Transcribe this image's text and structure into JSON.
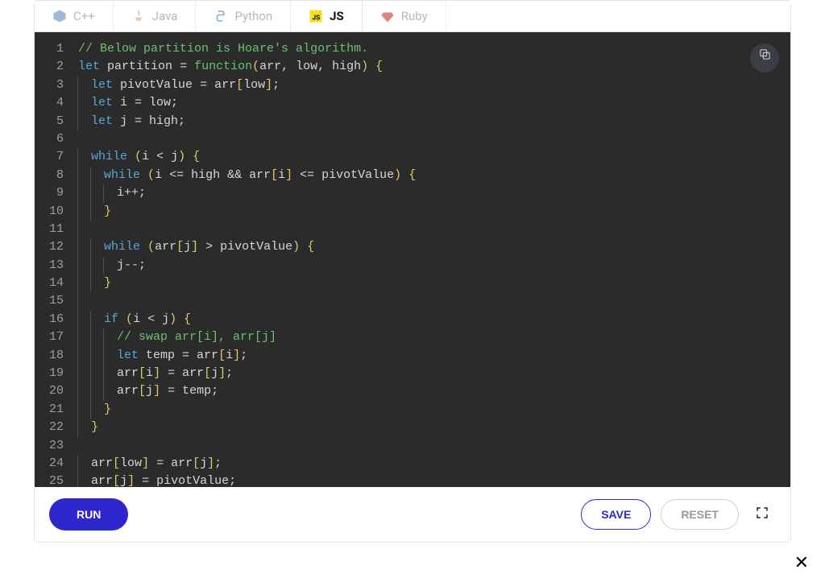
{
  "tabs": [
    {
      "label": "C++",
      "active": false
    },
    {
      "label": "Java",
      "active": false
    },
    {
      "label": "Python",
      "active": false
    },
    {
      "label": "JS",
      "active": true
    },
    {
      "label": "Ruby",
      "active": false
    }
  ],
  "buttons": {
    "run": "RUN",
    "save": "SAVE",
    "reset": "RESET"
  },
  "code_lines": [
    {
      "n": 1,
      "indent": 0,
      "tokens": [
        {
          "c": "comment",
          "t": "// Below partition is Hoare's algorithm."
        }
      ]
    },
    {
      "n": 2,
      "indent": 0,
      "tokens": [
        {
          "c": "keyword",
          "t": "let"
        },
        {
          "c": "op",
          "t": " "
        },
        {
          "c": "ident",
          "t": "partition"
        },
        {
          "c": "op",
          "t": " = "
        },
        {
          "c": "func",
          "t": "function"
        },
        {
          "c": "paren",
          "t": "("
        },
        {
          "c": "ident",
          "t": "arr, low, high"
        },
        {
          "c": "paren",
          "t": ")"
        },
        {
          "c": "op",
          "t": " "
        },
        {
          "c": "brace",
          "t": "{"
        }
      ]
    },
    {
      "n": 3,
      "indent": 1,
      "tokens": [
        {
          "c": "keyword",
          "t": "let"
        },
        {
          "c": "op",
          "t": " "
        },
        {
          "c": "ident",
          "t": "pivotValue = arr"
        },
        {
          "c": "bracket",
          "t": "["
        },
        {
          "c": "ident",
          "t": "low"
        },
        {
          "c": "bracket",
          "t": "]"
        },
        {
          "c": "op",
          "t": ";"
        }
      ]
    },
    {
      "n": 4,
      "indent": 1,
      "tokens": [
        {
          "c": "keyword",
          "t": "let"
        },
        {
          "c": "op",
          "t": " "
        },
        {
          "c": "ident",
          "t": "i = low;"
        }
      ]
    },
    {
      "n": 5,
      "indent": 1,
      "tokens": [
        {
          "c": "keyword",
          "t": "let"
        },
        {
          "c": "op",
          "t": " "
        },
        {
          "c": "ident",
          "t": "j = high;"
        }
      ]
    },
    {
      "n": 6,
      "indent": 1,
      "tokens": []
    },
    {
      "n": 7,
      "indent": 1,
      "tokens": [
        {
          "c": "keyword",
          "t": "while"
        },
        {
          "c": "op",
          "t": " "
        },
        {
          "c": "paren",
          "t": "("
        },
        {
          "c": "ident",
          "t": "i < j"
        },
        {
          "c": "paren",
          "t": ")"
        },
        {
          "c": "op",
          "t": " "
        },
        {
          "c": "brace",
          "t": "{"
        }
      ]
    },
    {
      "n": 8,
      "indent": 2,
      "tokens": [
        {
          "c": "keyword",
          "t": "while"
        },
        {
          "c": "op",
          "t": " "
        },
        {
          "c": "paren",
          "t": "("
        },
        {
          "c": "ident",
          "t": "i <= high && arr"
        },
        {
          "c": "bracket",
          "t": "["
        },
        {
          "c": "ident",
          "t": "i"
        },
        {
          "c": "bracket",
          "t": "]"
        },
        {
          "c": "ident",
          "t": " <= pivotValue"
        },
        {
          "c": "paren",
          "t": ")"
        },
        {
          "c": "op",
          "t": " "
        },
        {
          "c": "brace",
          "t": "{"
        }
      ]
    },
    {
      "n": 9,
      "indent": 3,
      "tokens": [
        {
          "c": "ident",
          "t": "i++;"
        }
      ]
    },
    {
      "n": 10,
      "indent": 2,
      "tokens": [
        {
          "c": "brace",
          "t": "}"
        }
      ]
    },
    {
      "n": 11,
      "indent": 2,
      "tokens": []
    },
    {
      "n": 12,
      "indent": 2,
      "tokens": [
        {
          "c": "keyword",
          "t": "while"
        },
        {
          "c": "op",
          "t": " "
        },
        {
          "c": "paren",
          "t": "("
        },
        {
          "c": "ident",
          "t": "arr"
        },
        {
          "c": "bracket",
          "t": "["
        },
        {
          "c": "ident",
          "t": "j"
        },
        {
          "c": "bracket",
          "t": "]"
        },
        {
          "c": "ident",
          "t": " > pivotValue"
        },
        {
          "c": "paren",
          "t": ")"
        },
        {
          "c": "op",
          "t": " "
        },
        {
          "c": "brace",
          "t": "{"
        }
      ]
    },
    {
      "n": 13,
      "indent": 3,
      "tokens": [
        {
          "c": "ident",
          "t": "j--;"
        }
      ]
    },
    {
      "n": 14,
      "indent": 2,
      "tokens": [
        {
          "c": "brace",
          "t": "}"
        }
      ]
    },
    {
      "n": 15,
      "indent": 2,
      "tokens": []
    },
    {
      "n": 16,
      "indent": 2,
      "tokens": [
        {
          "c": "keyword",
          "t": "if"
        },
        {
          "c": "op",
          "t": " "
        },
        {
          "c": "paren",
          "t": "("
        },
        {
          "c": "ident",
          "t": "i < j"
        },
        {
          "c": "paren",
          "t": ")"
        },
        {
          "c": "op",
          "t": " "
        },
        {
          "c": "brace",
          "t": "{"
        }
      ]
    },
    {
      "n": 17,
      "indent": 3,
      "tokens": [
        {
          "c": "comment",
          "t": "// swap arr[i], arr[j]"
        }
      ]
    },
    {
      "n": 18,
      "indent": 3,
      "tokens": [
        {
          "c": "keyword",
          "t": "let"
        },
        {
          "c": "op",
          "t": " "
        },
        {
          "c": "ident",
          "t": "temp = arr"
        },
        {
          "c": "bracket",
          "t": "["
        },
        {
          "c": "ident",
          "t": "i"
        },
        {
          "c": "bracket",
          "t": "]"
        },
        {
          "c": "op",
          "t": ";"
        }
      ]
    },
    {
      "n": 19,
      "indent": 3,
      "tokens": [
        {
          "c": "ident",
          "t": "arr"
        },
        {
          "c": "bracket",
          "t": "["
        },
        {
          "c": "ident",
          "t": "i"
        },
        {
          "c": "bracket",
          "t": "]"
        },
        {
          "c": "ident",
          "t": " = arr"
        },
        {
          "c": "bracket",
          "t": "["
        },
        {
          "c": "ident",
          "t": "j"
        },
        {
          "c": "bracket",
          "t": "]"
        },
        {
          "c": "op",
          "t": ";"
        }
      ]
    },
    {
      "n": 20,
      "indent": 3,
      "tokens": [
        {
          "c": "ident",
          "t": "arr"
        },
        {
          "c": "bracket",
          "t": "["
        },
        {
          "c": "ident",
          "t": "j"
        },
        {
          "c": "bracket",
          "t": "]"
        },
        {
          "c": "ident",
          "t": " = temp;"
        }
      ]
    },
    {
      "n": 21,
      "indent": 2,
      "tokens": [
        {
          "c": "brace",
          "t": "}"
        }
      ]
    },
    {
      "n": 22,
      "indent": 1,
      "tokens": [
        {
          "c": "brace",
          "t": "}"
        }
      ]
    },
    {
      "n": 23,
      "indent": 1,
      "tokens": []
    },
    {
      "n": 24,
      "indent": 1,
      "tokens": [
        {
          "c": "ident",
          "t": "arr"
        },
        {
          "c": "bracket",
          "t": "["
        },
        {
          "c": "ident",
          "t": "low"
        },
        {
          "c": "bracket",
          "t": "]"
        },
        {
          "c": "ident",
          "t": " = arr"
        },
        {
          "c": "bracket",
          "t": "["
        },
        {
          "c": "ident",
          "t": "j"
        },
        {
          "c": "bracket",
          "t": "]"
        },
        {
          "c": "op",
          "t": ";"
        }
      ]
    },
    {
      "n": 25,
      "indent": 1,
      "tokens": [
        {
          "c": "ident",
          "t": "arr"
        },
        {
          "c": "bracket",
          "t": "["
        },
        {
          "c": "ident",
          "t": "j"
        },
        {
          "c": "bracket",
          "t": "]"
        },
        {
          "c": "ident",
          "t": " = pivotValue;"
        }
      ]
    }
  ]
}
